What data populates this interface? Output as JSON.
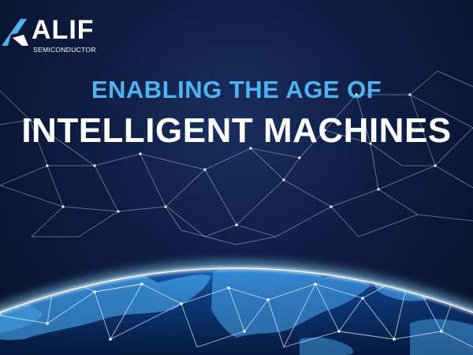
{
  "brand": {
    "name": "ALIF",
    "subtitle": "SEMICONDUCTOR"
  },
  "headline": {
    "line1": "ENABLING THE AGE OF",
    "line2": "INTELLIGENT MACHINES"
  },
  "colors": {
    "background": "#0a1530",
    "accent": "#4fb3f2",
    "text": "#ffffff",
    "globe_glow": "#7fd4ff"
  },
  "icons": {
    "logo_mark": "alif-logo-icon",
    "illustration": "earth-network-illustration"
  }
}
